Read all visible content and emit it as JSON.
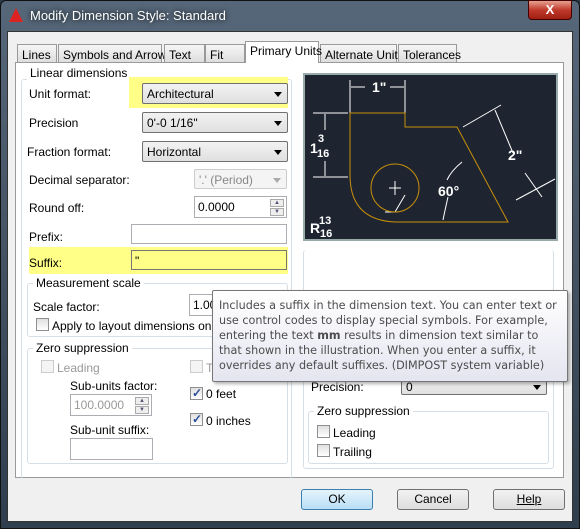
{
  "window": {
    "title": "Modify Dimension Style: Standard",
    "close": "X"
  },
  "tabs": [
    {
      "label": "Lines"
    },
    {
      "label": "Symbols and Arrows"
    },
    {
      "label": "Text"
    },
    {
      "label": "Fit"
    },
    {
      "label": "Primary Units",
      "active": true
    },
    {
      "label": "Alternate Units"
    },
    {
      "label": "Tolerances"
    }
  ],
  "linear": {
    "group": "Linear dimensions",
    "unit_format": {
      "label": "Unit format:",
      "value": "Architectural"
    },
    "precision": {
      "label": "Precision",
      "value": "0'-0 1/16\""
    },
    "fraction_format": {
      "label": "Fraction format:",
      "value": "Horizontal"
    },
    "decimal_separator": {
      "label": "Decimal separator:",
      "value": "'.' (Period)",
      "disabled": true
    },
    "round_off": {
      "label": "Round off:",
      "value": "0.0000"
    },
    "prefix": {
      "label": "Prefix:",
      "value": ""
    },
    "suffix": {
      "label": "Suffix:",
      "value": "\""
    }
  },
  "measurement": {
    "group": "Measurement scale",
    "scale_label": "Scale factor:",
    "scale_value": "1.00",
    "apply_label": "Apply to layout dimensions only",
    "apply_checked": false
  },
  "zero": {
    "group": "Zero suppression",
    "leading": "Leading",
    "trailing": "T",
    "subunits_factor_label": "Sub-units factor:",
    "subunits_factor": "100.0000",
    "subunit_suffix_label": "Sub-unit suffix:",
    "subunit_suffix": "",
    "feet": "0 feet",
    "feet_checked": true,
    "inches": "0 inches",
    "inches_checked": true
  },
  "angular": {
    "precision_label": "Precision:",
    "precision_value": "0",
    "zero_group": "Zero suppression",
    "leading": "Leading",
    "trailing": "Trailing"
  },
  "preview": {
    "dim_top": "1\"",
    "dim_left_whole": "1",
    "dim_left_num": "3",
    "dim_left_den": "16",
    "dim_right": "2\"",
    "angle": "60°",
    "radius_prefix": "R",
    "radius_num": "13",
    "radius_den": "16",
    "line_color": "#c8900a"
  },
  "tooltip": {
    "before": "Includes a suffix in the dimension text. You can enter text or use control codes to display special symbols. For example, entering the text ",
    "bold": "mm",
    "after": " results in dimension text similar to that shown in the illustration. When you enter a suffix, it overrides any default suffixes. (DIMPOST system variable)"
  },
  "buttons": {
    "ok": "OK",
    "cancel": "Cancel",
    "help": "Help"
  },
  "colors": {
    "highlight": "#ffff88",
    "preview_bg": "#1e2530"
  }
}
